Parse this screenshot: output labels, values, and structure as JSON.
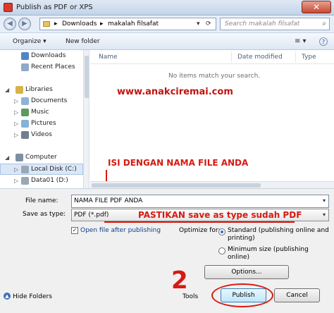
{
  "window": {
    "title": "Publish as PDF or XPS",
    "close": "✕"
  },
  "address": {
    "crumbs": [
      "Downloads",
      "makalah filsafat"
    ],
    "back": "◀",
    "forward": "▶",
    "sep": "▸",
    "refresh": "⟳",
    "search_placeholder": "Search makalah filsafat"
  },
  "toolbar": {
    "organize": "Organize ▾",
    "new_folder": "New folder",
    "view": "≡ ▾",
    "help": "?"
  },
  "nav": {
    "items": [
      {
        "label": "Downloads",
        "color": "#4f86c6"
      },
      {
        "label": "Recent Places",
        "color": "#8fa9c9"
      },
      {
        "label": "Libraries",
        "color": "#d7b34a"
      },
      {
        "label": "Documents",
        "color": "#8fb2d8"
      },
      {
        "label": "Music",
        "color": "#5e9a5e"
      },
      {
        "label": "Pictures",
        "color": "#86b3d4"
      },
      {
        "label": "Videos",
        "color": "#6f7f8f"
      },
      {
        "label": "Computer",
        "color": "#7e8fa3"
      },
      {
        "label": "Local Disk (C:)",
        "color": "#9aa7b5"
      },
      {
        "label": "Data01 (D:)",
        "color": "#9aa7b5"
      }
    ]
  },
  "list": {
    "columns": [
      "Name",
      "Date modified",
      "Type"
    ],
    "empty_message": "No items match your search.",
    "watermark": "www.anakciremai.com",
    "annotation": "ISI DENGAN NAMA FILE ANDA"
  },
  "form": {
    "file_name_label": "File name:",
    "file_name_value": "NAMA FILE PDF ANDA",
    "save_type_label": "Save as type:",
    "save_type_value": "PDF (*.pdf)",
    "annotation": "PASTIKAN save as type sudah PDF",
    "open_after_label": "Open file after publishing",
    "optimize_label": "Optimize for:",
    "opt_standard": "Standard (publishing online and printing)",
    "opt_minimum": "Minimum size (publishing online)",
    "options_btn": "Options...",
    "hide_folders": "Hide Folders",
    "tools": "Tools",
    "publish": "Publish",
    "cancel": "Cancel",
    "step_number": "2"
  }
}
